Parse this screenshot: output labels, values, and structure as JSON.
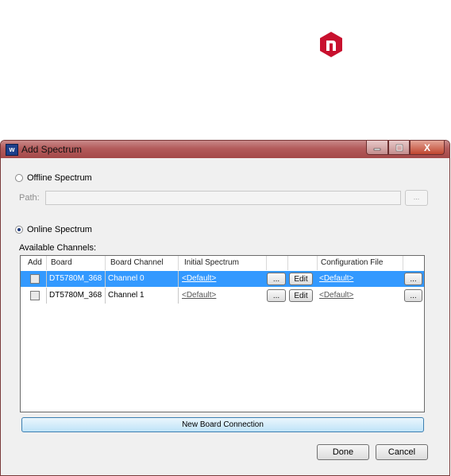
{
  "window": {
    "title": "Add Spectrum",
    "icon_name": "app-icon",
    "close_glyph": "X"
  },
  "offline": {
    "label": "Offline Spectrum",
    "selected": false,
    "path_label": "Path:",
    "path_value": "",
    "browse_label": "..."
  },
  "online": {
    "label": "Online Spectrum",
    "selected": true
  },
  "channels": {
    "label": "Available Channels:",
    "columns": [
      "Add",
      "Board",
      "Board Channel",
      "Initial Spectrum",
      "Configuration File"
    ],
    "rows": [
      {
        "add": false,
        "board": "DT5780M_368",
        "channel": "Channel 0",
        "spectrum": "<Default>",
        "spectrum_browse": "...",
        "edit": "Edit",
        "config": "<Default>",
        "config_browse": "...",
        "selected": true
      },
      {
        "add": false,
        "board": "DT5780M_368",
        "channel": "Channel 1",
        "spectrum": "<Default>",
        "spectrum_browse": "...",
        "edit": "Edit",
        "config": "<Default>",
        "config_browse": "...",
        "selected": false
      }
    ]
  },
  "buttons": {
    "new_connection": "New Board Connection",
    "done": "Done",
    "cancel": "Cancel"
  },
  "colors": {
    "selection": "#3399ff",
    "logo": "#c8102e",
    "titlebar": "#b35b5b"
  }
}
